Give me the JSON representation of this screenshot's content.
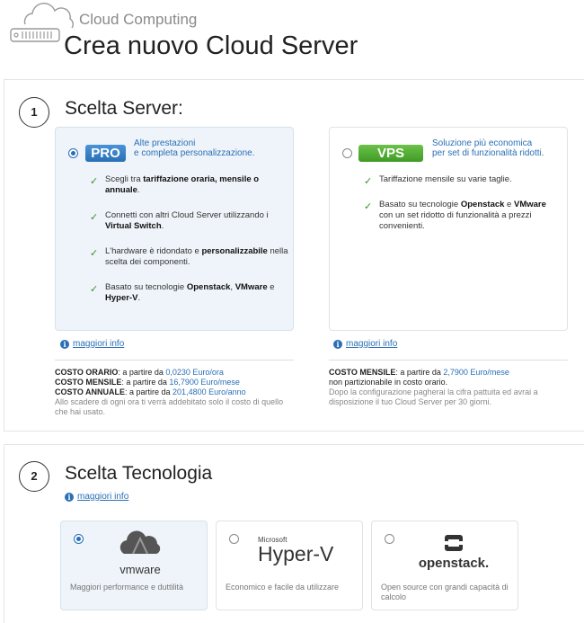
{
  "header": {
    "brand": "Cloud Computing",
    "title": "Crea nuovo Cloud Server"
  },
  "step1": {
    "number": "1",
    "title": "Scelta Server:",
    "pro": {
      "badge": "PRO",
      "desc_line1": "Alte prestazioni",
      "desc_line2": "e completa personalizzazione.",
      "features": [
        [
          "Scegli tra ",
          "tariffazione oraria, mensile o annuale",
          "."
        ],
        [
          "Connetti con altri Cloud Server utilizzando i ",
          "Virtual Switch",
          "."
        ],
        [
          "L'hardware è ridondato e ",
          "personalizzabile",
          " nella scelta dei componenti."
        ],
        [
          "Basato su tecnologie ",
          "Openstack",
          ", ",
          "VMware",
          " e ",
          "Hyper-V",
          "."
        ]
      ],
      "info_link": "maggiori info",
      "pricing": {
        "l1_label": "COSTO ORARIO",
        "l1_text": ": a partire da ",
        "l1_value": "0,0230 Euro/ora",
        "l2_label": "COSTO MENSILE",
        "l2_text": ": a partire da ",
        "l2_value": "16,7900 Euro/mese",
        "l3_label": "COSTO ANNUALE",
        "l3_text": ": a partire da ",
        "l3_value": "201,4800 Euro/anno",
        "note": "Allo scadere di ogni ora ti verrà addebitato solo il costo di quello che hai usato."
      }
    },
    "vps": {
      "badge": "VPS",
      "desc_line1": "Soluzione più economica",
      "desc_line2": "per set di funzionalità ridotti.",
      "features": [
        [
          "Tariffazione mensile su varie taglie."
        ],
        [
          "Basato su tecnologie ",
          "Openstack",
          " e ",
          "VMware",
          " con un set ridotto di funzionalità a prezzi convenienti."
        ]
      ],
      "info_link": "maggiori info",
      "pricing": {
        "l1_label": "COSTO MENSILE",
        "l1_text": ": a partire da ",
        "l1_value": "2,7900 Euro/mese",
        "l2": "non partizionabile in costo orario.",
        "note": "Dopo la configurazione pagherai la cifra pattuita ed avrai a disposizione il tuo Cloud Server per 30 giorni."
      }
    }
  },
  "step2": {
    "number": "2",
    "title": "Scelta Tecnologia",
    "info_link": "maggiori info",
    "options": [
      {
        "logo": "vmware",
        "desc": "Maggiori performance e duttilità"
      },
      {
        "logo_small": "Microsoft",
        "logo": "Hyper-V",
        "desc": "Economico e facile da utilizzare"
      },
      {
        "logo": "openstack.",
        "desc": "Open source con grandi capacità di calcolo"
      }
    ]
  },
  "colors": {
    "accent": "#2a6fb5",
    "pro_badge": "#2a6fb5",
    "vps_badge": "#4fae2f",
    "check": "#3a8f2e"
  }
}
